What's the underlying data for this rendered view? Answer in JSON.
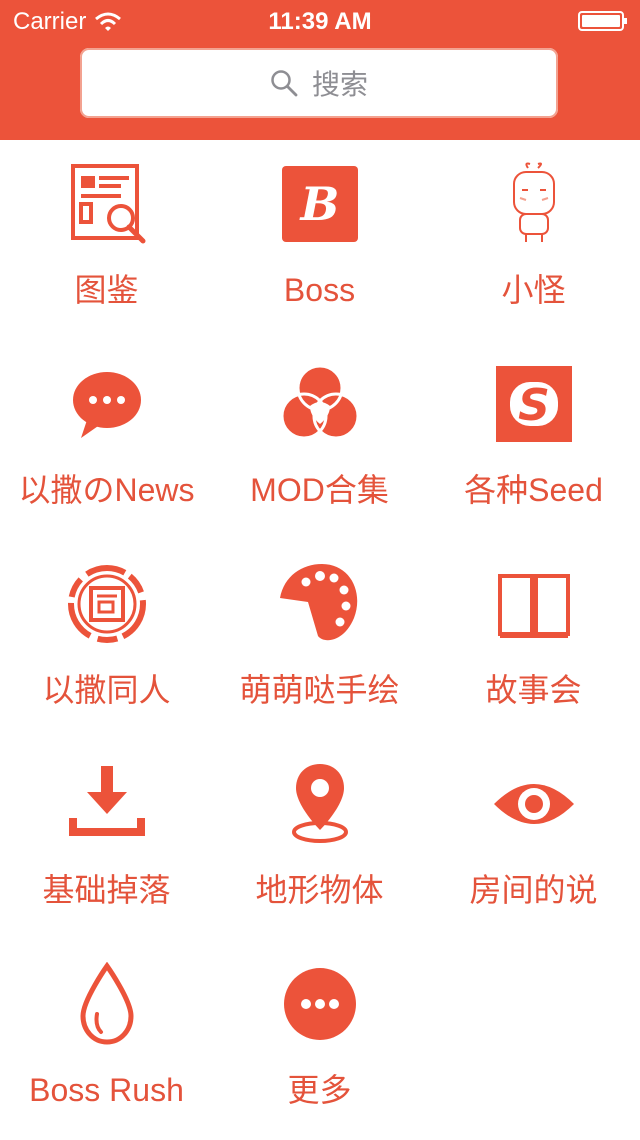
{
  "status_bar": {
    "carrier": "Carrier",
    "time": "11:39 AM"
  },
  "search": {
    "placeholder": "搜索"
  },
  "colors": {
    "accent": "#ec533a",
    "label": "#e4533b"
  },
  "items": [
    {
      "label": "图鉴",
      "icon": "encyclopedia-icon"
    },
    {
      "label": "Boss",
      "icon": "boss-icon"
    },
    {
      "label": "小怪",
      "icon": "monster-icon"
    },
    {
      "label": "以撒のNews",
      "icon": "chat-bubble-icon"
    },
    {
      "label": "MOD合集",
      "icon": "mod-collection-icon"
    },
    {
      "label": "各种Seed",
      "icon": "seed-icon"
    },
    {
      "label": "以撒同人",
      "icon": "fan-art-icon"
    },
    {
      "label": "萌萌哒手绘",
      "icon": "palette-icon"
    },
    {
      "label": "故事会",
      "icon": "book-icon"
    },
    {
      "label": "基础掉落",
      "icon": "download-icon"
    },
    {
      "label": "地形物体",
      "icon": "map-pin-icon"
    },
    {
      "label": "房间的说",
      "icon": "eye-icon"
    },
    {
      "label": "Boss Rush",
      "icon": "drop-icon"
    },
    {
      "label": "更多",
      "icon": "more-icon"
    }
  ]
}
